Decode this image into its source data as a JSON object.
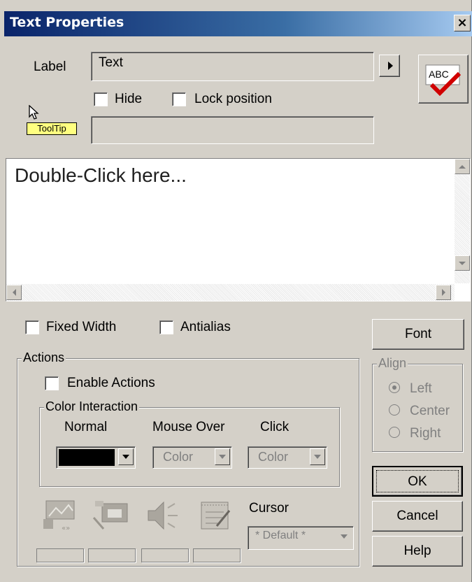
{
  "window": {
    "title": "Text Properties",
    "close_label": "×"
  },
  "label_section": {
    "label": "Label",
    "value": "Text",
    "hide_label": "Hide",
    "lock_label": "Lock position",
    "tooltip_badge": "ToolTip",
    "tooltip_value": ""
  },
  "spell_button": {
    "text": "ABC"
  },
  "editor": {
    "placeholder": "Double-Click here..."
  },
  "options": {
    "fixed_width_label": "Fixed Width",
    "antialias_label": "Antialias"
  },
  "actions": {
    "group_label": "Actions",
    "enable_label": "Enable Actions",
    "color_interaction": {
      "group_label": "Color Interaction",
      "normal_label": "Normal",
      "mouse_over_label": "Mouse Over",
      "click_label": "Click",
      "normal_color": "#000000",
      "mouse_over_value": "Color",
      "click_value": "Color"
    },
    "icons": [
      "image-link-icon",
      "camera-icon",
      "speaker-icon",
      "note-icon"
    ],
    "cursor_label": "Cursor",
    "cursor_value": "* Default *"
  },
  "align": {
    "group_label": "Align",
    "options": [
      "Left",
      "Center",
      "Right"
    ],
    "selected": "Left"
  },
  "buttons": {
    "font": "Font",
    "ok": "OK",
    "cancel": "Cancel",
    "help": "Help"
  }
}
